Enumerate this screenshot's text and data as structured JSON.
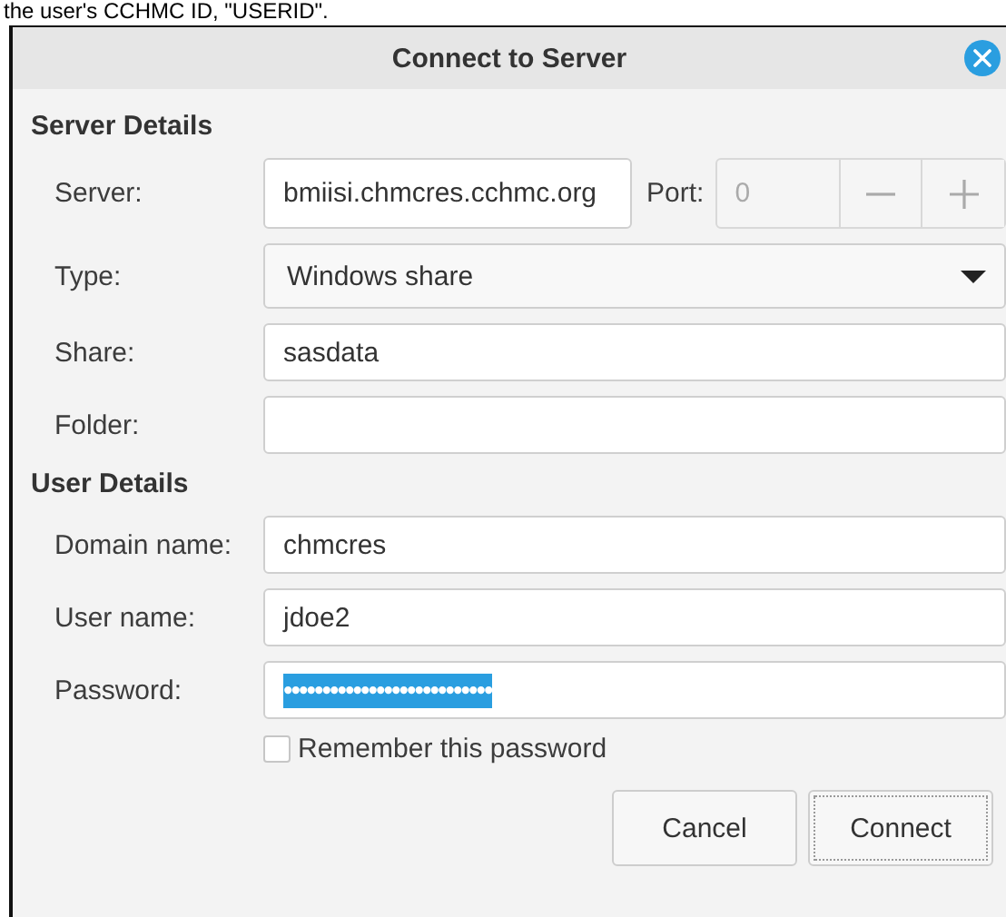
{
  "page_text": "the user's CCHMC ID, \"USERID\".",
  "dialog": {
    "title": "Connect to Server",
    "sections": [
      {
        "heading": "Server Details",
        "rows": [
          {
            "kind": "server",
            "label": "Server:",
            "value": "bmiisi.chmcres.cchmc.org",
            "port": {
              "label": "Port:",
              "value": "0",
              "disabled": true
            }
          },
          {
            "kind": "dropdown",
            "label": "Type:",
            "value": "Windows share"
          },
          {
            "kind": "text",
            "label": "Share:",
            "value": "sasdata"
          },
          {
            "kind": "text",
            "label": "Folder:"
          }
        ]
      },
      {
        "heading": "User Details",
        "rows": [
          {
            "kind": "text",
            "label": "Domain name:",
            "value": "chmcres"
          },
          {
            "kind": "text",
            "label": "User name:",
            "value": "jdoe2"
          },
          {
            "kind": "password",
            "label": "Password:",
            "value": "•••••••••••••••••••••••••••",
            "selected": true
          }
        ]
      }
    ],
    "remember": {
      "label": "Remember this password",
      "checked": false
    },
    "buttons": [
      {
        "label": "Cancel",
        "focused": false
      },
      {
        "label": "Connect",
        "focused": true
      }
    ]
  }
}
